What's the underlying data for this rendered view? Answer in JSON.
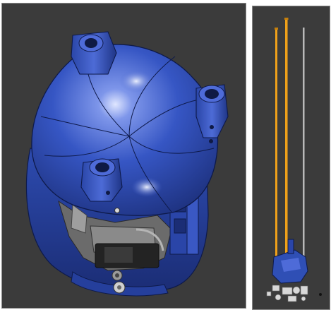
{
  "viewports": [
    {
      "name": "left-viewport",
      "subject": "blue-enclosure-top-view",
      "background": "#3b3b3b",
      "colors": {
        "body": "#2f4fb5",
        "body_dark": "#1e3588",
        "body_light": "#6f8be6",
        "highlight": "#c9d6ff",
        "edge": "#0e1a4a",
        "mechanism": "#6b6b6b",
        "mechanism_dark": "#232323"
      }
    },
    {
      "name": "right-viewport",
      "subject": "side-view-with-rods",
      "background": "#3b3b3b",
      "colors": {
        "rod": "#f0a11a",
        "rod_gray": "#b8b8b8",
        "body": "#2f4fb5",
        "parts": "#d8d8d8"
      }
    }
  ]
}
